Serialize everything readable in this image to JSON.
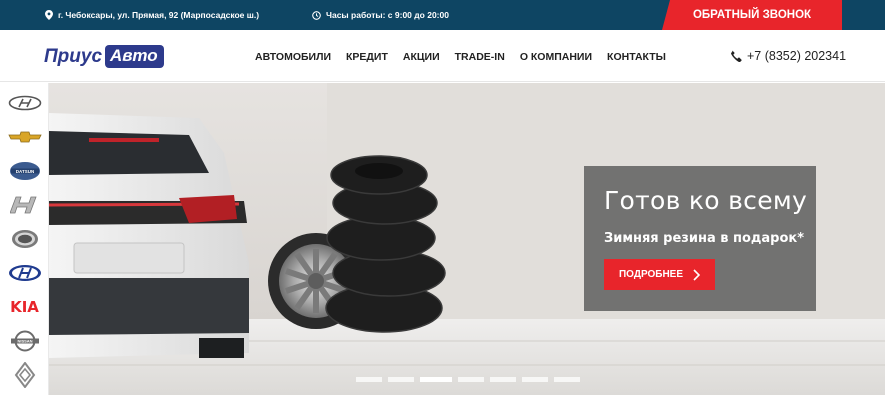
{
  "topbar": {
    "address": "г. Чебоксары, ул. Прямая, 92 (Марпосадское ш.)",
    "hours": "Часы работы: с 9:00 до 20:00",
    "callback_label": "ОБРАТНЫЙ ЗВОНОК",
    "address_icon": "location-pin-icon",
    "hours_icon": "clock-icon"
  },
  "header": {
    "logo_part1": "Приус",
    "logo_part2": "Авто",
    "nav": [
      "АВТОМОБИЛИ",
      "КРЕДИТ",
      "АКЦИИ",
      "TRADE-IN",
      "О КОМПАНИИ",
      "КОНТАКТЫ"
    ],
    "phone": "+7 (8352) 202341",
    "phone_icon": "phone-icon"
  },
  "brands": {
    "items": [
      "hyundai",
      "chevrolet",
      "datsun",
      "haval",
      "geely",
      "hyundai",
      "kia",
      "nissan",
      "renault"
    ],
    "kia_text": "KIA"
  },
  "slider": {
    "title": "Готов ко всему",
    "subtitle": "Зимняя резина в подарок*",
    "button_label": "ПОДРОБНЕЕ",
    "button_icon": "chevron-right-icon",
    "slide_count": 7,
    "active_index": 2
  },
  "colors": {
    "topbar_bg": "#0e4563",
    "accent_red": "#e8252b",
    "logo_blue": "#2d3a8c"
  }
}
